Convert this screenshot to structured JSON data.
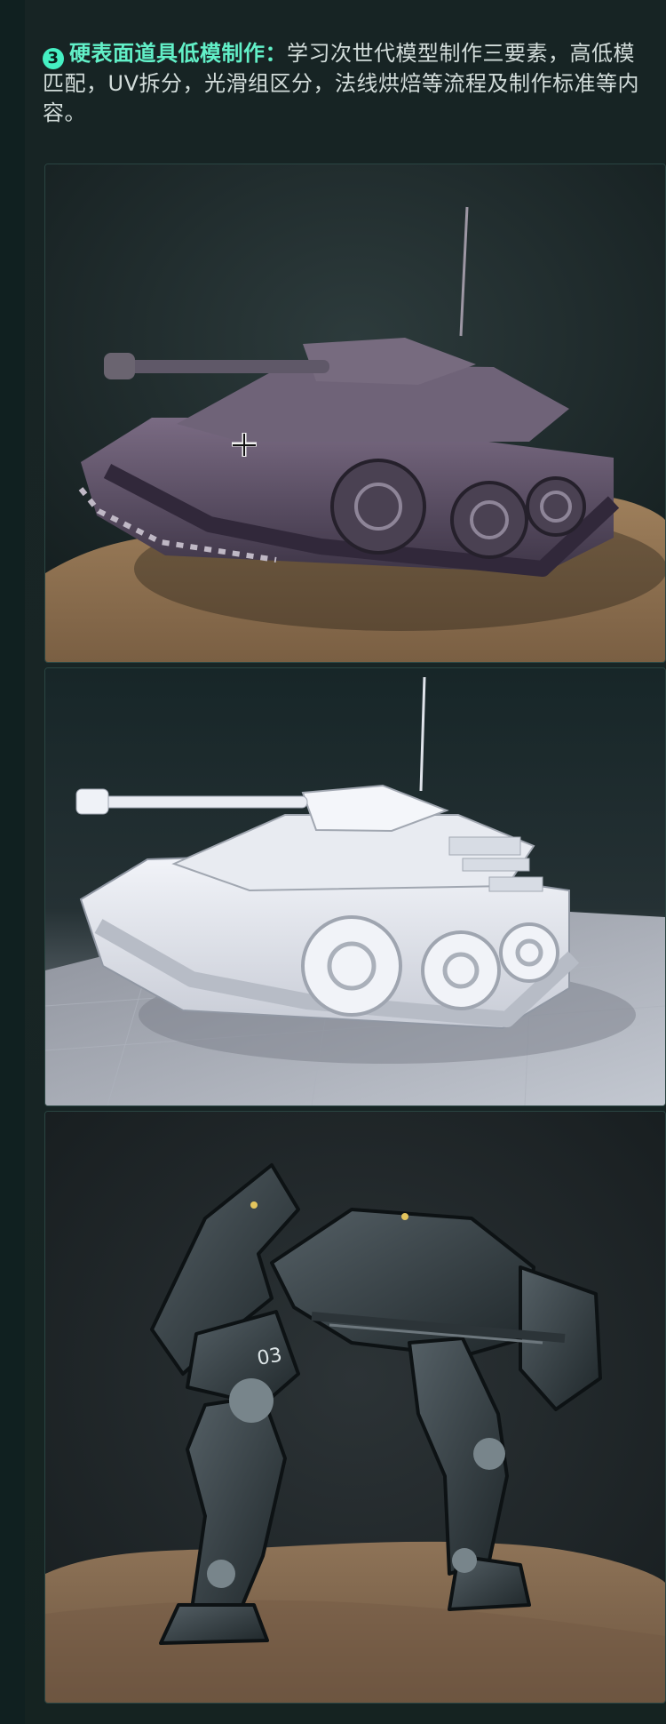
{
  "section": {
    "badge": "3",
    "heading": "硬表面道具低模制作：",
    "body": "学习次世代模型制作三要素，高低模匹配，UV拆分，光滑组区分，法线烘焙等流程及制作标准等内容。"
  },
  "colors": {
    "background": "#172424",
    "accent": "#62f0c8",
    "text": "#d2dcda"
  },
  "images": [
    {
      "subject": "textured tank model on dirt ground"
    },
    {
      "subject": "white clay-render tank model on gray floor"
    },
    {
      "subject": "dark mechanical walker robot on dirt ground"
    }
  ]
}
